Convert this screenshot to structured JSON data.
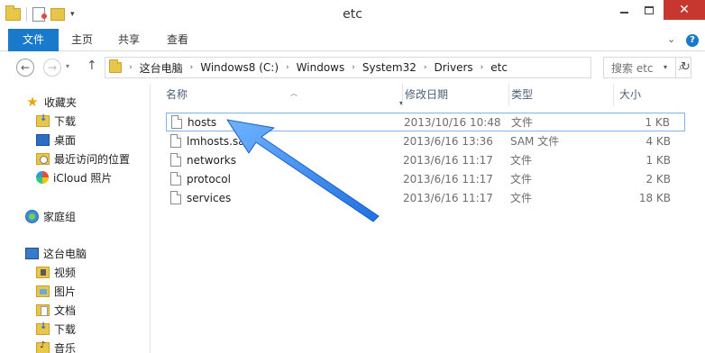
{
  "window": {
    "title": "etc",
    "close_glyph": "✕"
  },
  "ribbon": {
    "tabs": [
      "文件",
      "主页",
      "共享",
      "查看"
    ]
  },
  "address": {
    "crumbs": [
      "这台电脑",
      "Windows8 (C:)",
      "Windows",
      "System32",
      "Drivers",
      "etc"
    ],
    "search_placeholder": "搜索 etc"
  },
  "nav_pane": {
    "favorites": {
      "label": "收藏夹",
      "items": [
        "下载",
        "桌面",
        "最近访问的位置",
        "iCloud 照片"
      ]
    },
    "homegroup": {
      "label": "家庭组"
    },
    "this_pc": {
      "label": "这台电脑",
      "items": [
        "视频",
        "图片",
        "文档",
        "下载",
        "音乐"
      ]
    }
  },
  "columns": {
    "name": "名称",
    "date": "修改日期",
    "type": "类型",
    "size": "大小"
  },
  "files": [
    {
      "name": "hosts",
      "date": "2013/10/16 10:48",
      "type": "文件",
      "size": "1 KB",
      "selected": true
    },
    {
      "name": "lmhosts.sam",
      "date": "2013/6/16 13:36",
      "type": "SAM 文件",
      "size": "4 KB",
      "selected": false
    },
    {
      "name": "networks",
      "date": "2013/6/16 11:17",
      "type": "文件",
      "size": "1 KB",
      "selected": false
    },
    {
      "name": "protocol",
      "date": "2013/6/16 11:17",
      "type": "文件",
      "size": "2 KB",
      "selected": false
    },
    {
      "name": "services",
      "date": "2013/6/16 11:17",
      "type": "文件",
      "size": "18 KB",
      "selected": false
    }
  ],
  "colors": {
    "accent": "#1979ca",
    "close_button": "#c7372f",
    "selection_border": "#7eb4ea",
    "annotation_arrow": "#2f8cf0"
  },
  "icons": {
    "annotation": "arrow-pointer-icon"
  }
}
